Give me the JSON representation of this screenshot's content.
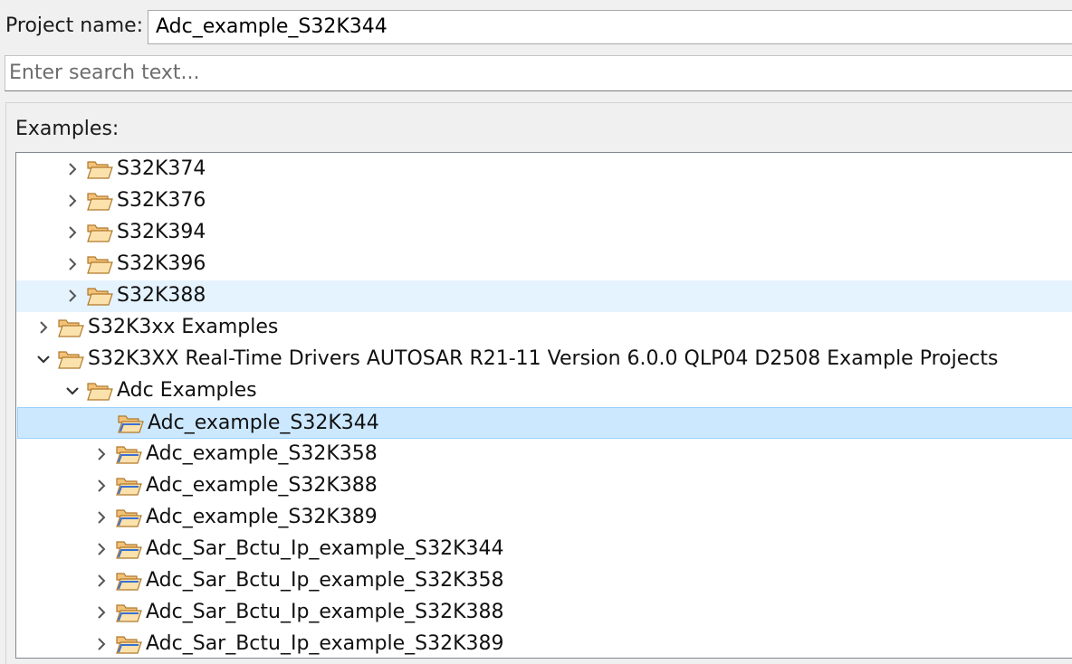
{
  "project": {
    "label": "Project name:",
    "value": "Adc_example_S32K344"
  },
  "search": {
    "placeholder": "Enter search text..."
  },
  "examples_label": "Examples:",
  "tree": {
    "rows": [
      {
        "label": "S32K374",
        "level": 2,
        "expanded": false,
        "icon": "folder-open-icon"
      },
      {
        "label": "S32K376",
        "level": 2,
        "expanded": false,
        "icon": "folder-open-icon"
      },
      {
        "label": "S32K394",
        "level": 2,
        "expanded": false,
        "icon": "folder-open-icon"
      },
      {
        "label": "S32K396",
        "level": 2,
        "expanded": false,
        "icon": "folder-open-icon"
      },
      {
        "label": "S32K388",
        "level": 2,
        "expanded": false,
        "icon": "folder-open-icon",
        "state": "hover"
      },
      {
        "label": "S32K3xx Examples",
        "level": 1,
        "expanded": false,
        "icon": "folder-open-icon"
      },
      {
        "label": "S32K3XX Real-Time Drivers AUTOSAR R21-11 Version 6.0.0 QLP04 D2508 Example Projects",
        "level": 1,
        "expanded": true,
        "icon": "folder-open-icon"
      },
      {
        "label": "Adc Examples",
        "level": 2,
        "expanded": true,
        "icon": "folder-open-icon"
      },
      {
        "label": "Adc_example_S32K344",
        "level": 3,
        "expanded": false,
        "icon": "project-folder-icon",
        "state": "selected",
        "noChevron": true
      },
      {
        "label": "Adc_example_S32K358",
        "level": 3,
        "expanded": false,
        "icon": "project-folder-icon"
      },
      {
        "label": "Adc_example_S32K388",
        "level": 3,
        "expanded": false,
        "icon": "project-folder-icon"
      },
      {
        "label": "Adc_example_S32K389",
        "level": 3,
        "expanded": false,
        "icon": "project-folder-icon"
      },
      {
        "label": "Adc_Sar_Bctu_Ip_example_S32K344",
        "level": 3,
        "expanded": false,
        "icon": "project-folder-icon"
      },
      {
        "label": "Adc_Sar_Bctu_Ip_example_S32K358",
        "level": 3,
        "expanded": false,
        "icon": "project-folder-icon"
      },
      {
        "label": "Adc_Sar_Bctu_Ip_example_S32K388",
        "level": 3,
        "expanded": false,
        "icon": "project-folder-icon"
      },
      {
        "label": "Adc_Sar_Bctu_Ip_example_S32K389",
        "level": 3,
        "expanded": false,
        "icon": "project-folder-icon"
      }
    ]
  }
}
